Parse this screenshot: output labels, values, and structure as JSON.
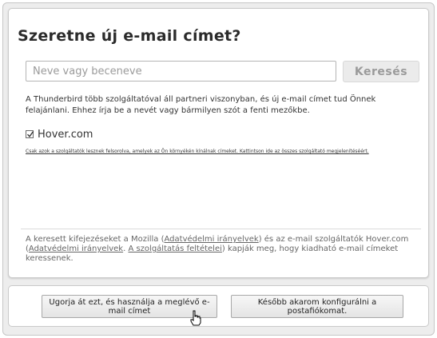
{
  "dialog": {
    "title": "Szeretne új e-mail címet?",
    "search": {
      "placeholder": "Neve vagy beceneve",
      "value": "",
      "button_label": "Keresés"
    },
    "description": "A Thunderbird több szolgáltatóval áll partneri viszonyban, és új e-mail címet tud Önnek felajánlani. Ehhez írja be a nevét vagy bármilyen szót a fenti mezőkbe.",
    "provider": {
      "label": "Hover.com",
      "checked": true
    },
    "terms_note": "Csak azok a szolgáltatók lesznek felsorolva, amelyek az Ön környékén kínálnak címeket. Kattintson ide az összes szolgáltató megjelenítéséért.",
    "privacy": {
      "text_1": "A keresett kifejezéseket a Mozilla (",
      "link_mozilla_privacy": "Adatvédelmi irányelvek",
      "text_2": ") és az e-mail szolgáltatók Hover.com (",
      "link_hover_privacy": "Adatvédelmi irányelvek",
      "text_3": ". ",
      "link_hover_terms": "A szolgáltatás feltételei",
      "text_4": ") kapják meg, hogy kiadható e-mail címeket keressenek."
    }
  },
  "buttons": {
    "use_existing": "Ugorja át ezt, és használja a meglévő e-mail címet",
    "configure_later": "Később akarom konfigurálni a postafiókomat."
  },
  "colors": {
    "background": "#ededed",
    "panel": "#ffffff",
    "title": "#2b2b2b"
  }
}
